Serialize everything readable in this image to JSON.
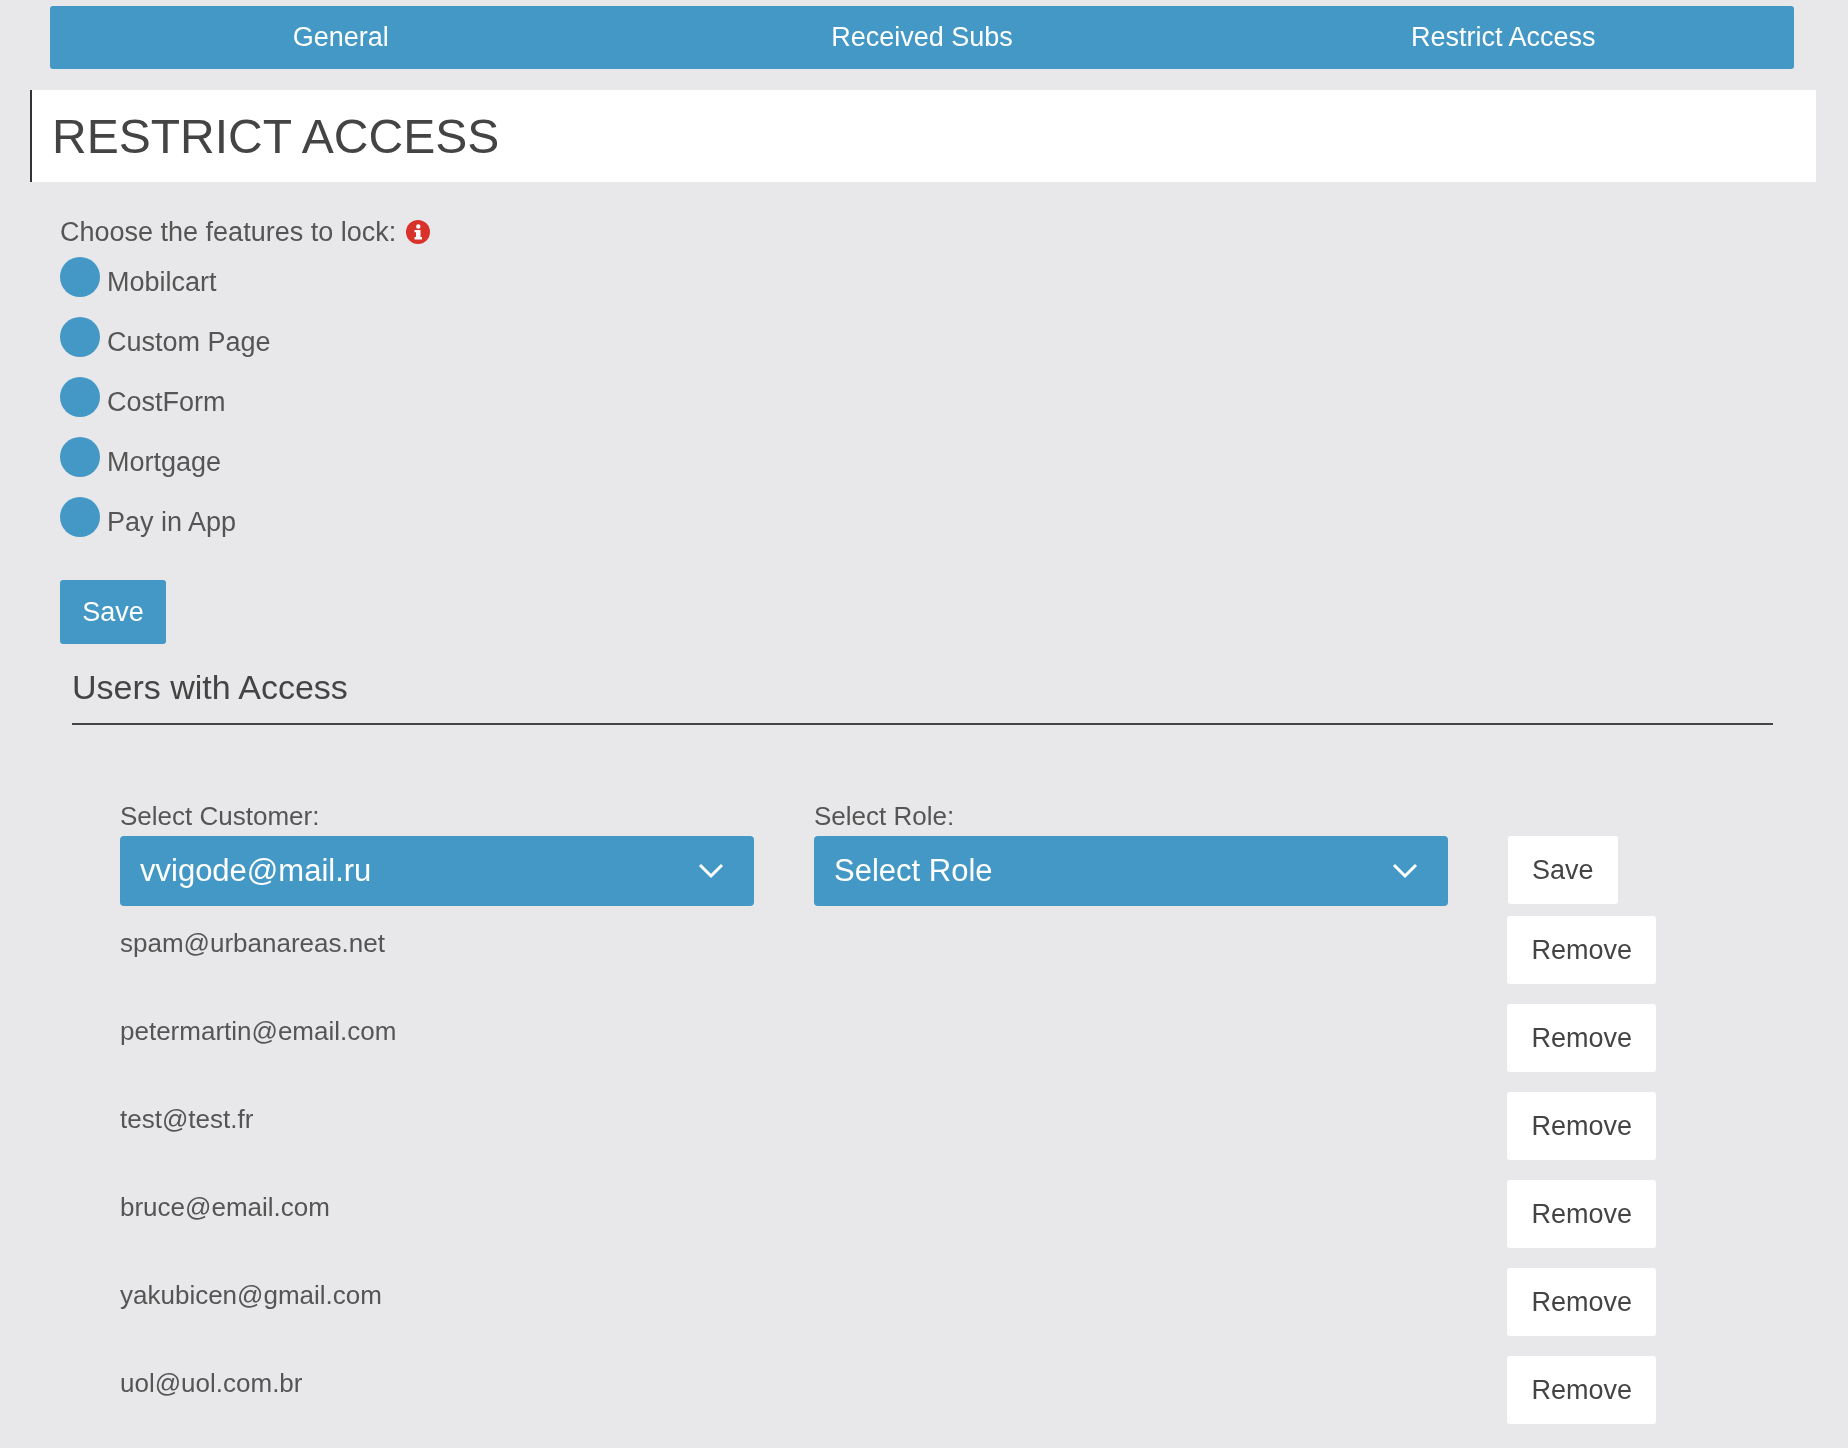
{
  "tabs": [
    {
      "label": "General"
    },
    {
      "label": "Received Subs"
    },
    {
      "label": "Restrict Access"
    }
  ],
  "page_title": "RESTRICT ACCESS",
  "features": {
    "prompt": "Choose the features to lock:",
    "items": [
      {
        "label": "Mobilcart",
        "checked": false
      },
      {
        "label": "Custom Page",
        "checked": false
      },
      {
        "label": "CostForm",
        "checked": false
      },
      {
        "label": "Mortgage",
        "checked": false
      },
      {
        "label": "Pay in App",
        "checked": false
      }
    ],
    "save_button": "Save"
  },
  "users": {
    "heading": "Users with Access",
    "customer_label": "Select Customer:",
    "customer_value": "vvigode@mail.ru",
    "role_label": "Select Role:",
    "role_value": "Select Role",
    "save_button": "Save",
    "rows": [
      {
        "email": "spam@urbanareas.net",
        "button": "Remove"
      },
      {
        "email": "petermartin@email.com",
        "button": "Remove"
      },
      {
        "email": "test@test.fr",
        "button": "Remove"
      },
      {
        "email": "bruce@email.com",
        "button": "Remove"
      },
      {
        "email": "yakubicen@gmail.com",
        "button": "Remove"
      },
      {
        "email": "uol@uol.com.br",
        "button": "Remove"
      }
    ]
  }
}
